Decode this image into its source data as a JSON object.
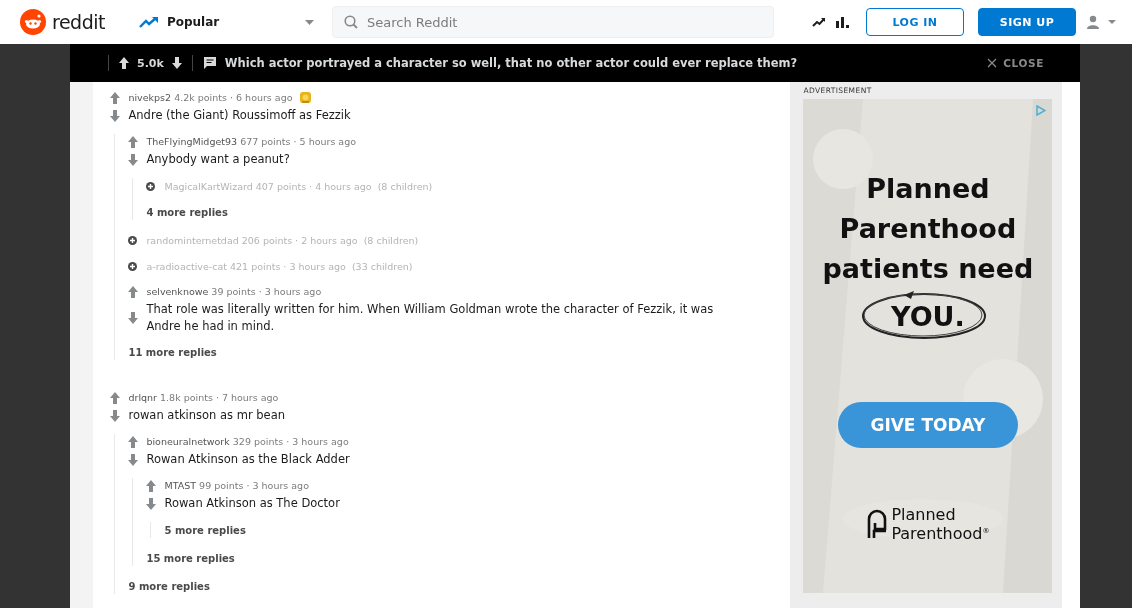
{
  "header": {
    "logo_text": "reddit",
    "feed": "Popular",
    "search": {
      "placeholder": "Search Reddit"
    },
    "buttons": [
      {
        "label": "LOG IN",
        "kind": "outline"
      },
      {
        "label": "SIGN UP",
        "kind": "filled"
      }
    ]
  },
  "post_bar": {
    "score": "5.0k",
    "title": "Which actor portrayed a character so well, that no other actor could ever replace them?",
    "close": "CLOSE"
  },
  "comments": [
    {
      "kind": "comment",
      "author": "nivekps2",
      "points": "4.2k points",
      "separator": "·",
      "time": "6 hours ago",
      "award": true,
      "body": "Andre (the Giant) Roussimoff as Fezzik",
      "children": [
        {
          "kind": "comment",
          "author": "TheFlyingMidget93",
          "points": "677 points",
          "separator": "·",
          "time": "5 hours ago",
          "body": "Anybody want a peanut?",
          "children": [
            {
              "kind": "collapsed",
              "author": "MagicalKartWizard",
              "points": "407 points",
              "separator": "·",
              "time": "4 hours ago",
              "count": "(8 children)"
            },
            {
              "kind": "more",
              "label": "4 more replies"
            }
          ]
        },
        {
          "kind": "collapsed",
          "author": "randominternetdad",
          "points": "206 points",
          "separator": "·",
          "time": "2 hours ago",
          "count": "(8 children)"
        },
        {
          "kind": "collapsed",
          "author": "a-radioactive-cat",
          "points": "421 points",
          "separator": "·",
          "time": "3 hours ago",
          "count": "(33 children)"
        },
        {
          "kind": "comment",
          "author": "selvenknowe",
          "points": "39 points",
          "separator": "·",
          "time": "3 hours ago",
          "body": "That role was literally written for him. When William Goldman wrote the character of Fezzik, it was Andre he had in mind."
        },
        {
          "kind": "more",
          "label": "11 more replies"
        }
      ]
    },
    {
      "kind": "comment",
      "author": "drlqnr",
      "points": "1.8k points",
      "separator": "·",
      "time": "7 hours ago",
      "body": "rowan atkinson as mr bean",
      "children": [
        {
          "kind": "comment",
          "author": "bioneuralnetwork",
          "points": "329 points",
          "separator": "·",
          "time": "3 hours ago",
          "body": "Rowan Atkinson as the Black Adder",
          "children": [
            {
              "kind": "comment",
              "author": "MTAST",
              "points": "99 points",
              "separator": "·",
              "time": "3 hours ago",
              "body": "Rowan Atkinson as The Doctor",
              "children": [
                {
                  "kind": "more",
                  "label": "5 more replies"
                }
              ]
            },
            {
              "kind": "more",
              "label": "15 more replies"
            }
          ]
        },
        {
          "kind": "more",
          "label": "9 more replies"
        }
      ]
    }
  ],
  "ad": {
    "label": "ADVERTISEMENT",
    "headline": [
      "Planned",
      "Parenthood",
      "patients need"
    ],
    "circled": "YOU.",
    "cta": "GIVE TODAY",
    "brand": [
      "Planned",
      "Parenthood"
    ],
    "brand_mark": "®"
  }
}
